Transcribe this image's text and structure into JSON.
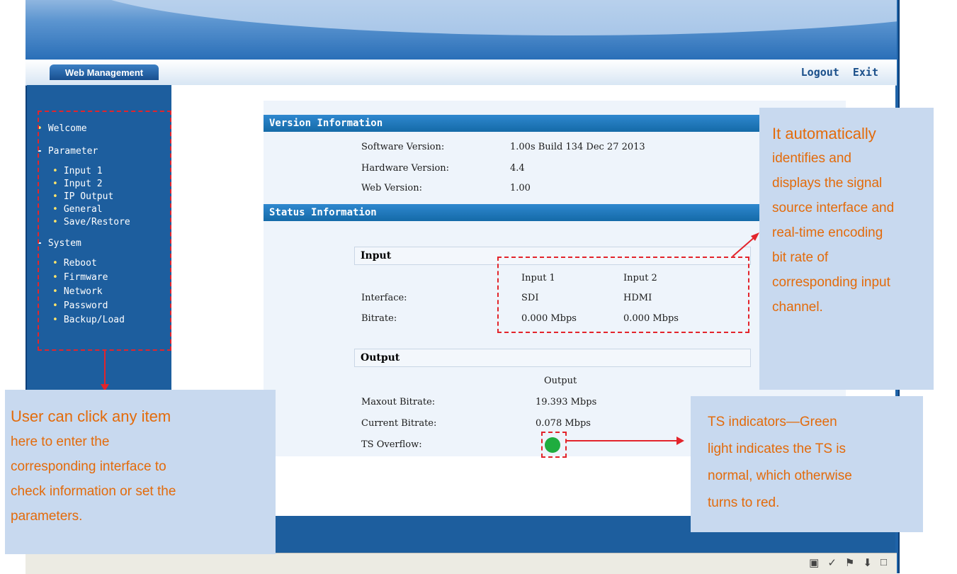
{
  "header": {
    "tab_label": "Web Management",
    "logout_label": "Logout",
    "exit_label": "Exit"
  },
  "sidebar": {
    "items": [
      {
        "label": "Welcome",
        "level": 0,
        "marker": "•"
      },
      {
        "label": "Parameter",
        "level": 0,
        "marker": "-"
      },
      {
        "label": "Input 1",
        "level": 1,
        "marker": "•"
      },
      {
        "label": "Input 2",
        "level": 1,
        "marker": "•"
      },
      {
        "label": "IP Output",
        "level": 1,
        "marker": "•"
      },
      {
        "label": "General",
        "level": 1,
        "marker": "•"
      },
      {
        "label": "Save/Restore",
        "level": 1,
        "marker": "•"
      },
      {
        "label": "System",
        "level": 0,
        "marker": "-"
      },
      {
        "label": "Reboot",
        "level": 1,
        "marker": "•"
      },
      {
        "label": "Firmware",
        "level": 1,
        "marker": "•"
      },
      {
        "label": "Network",
        "level": 1,
        "marker": "•"
      },
      {
        "label": "Password",
        "level": 1,
        "marker": "•"
      },
      {
        "label": "Backup/Load",
        "level": 1,
        "marker": "•"
      }
    ]
  },
  "version": {
    "title": "Version Information",
    "software_label": "Software Version:",
    "software_value": "1.00s Build 134 Dec 27 2013",
    "hardware_label": "Hardware Version:",
    "hardware_value": "4.4",
    "web_label": "Web Version:",
    "web_value": "1.00"
  },
  "status": {
    "title": "Status Information",
    "input": {
      "heading": "Input",
      "col1": "Input 1",
      "col2": "Input 2",
      "interface_label": "Interface:",
      "interface_1": "SDI",
      "interface_2": "HDMI",
      "bitrate_label": "Bitrate:",
      "bitrate_1": "0.000 Mbps",
      "bitrate_2": "0.000 Mbps"
    },
    "output": {
      "heading": "Output",
      "col": "Output",
      "maxout_label": "Maxout Bitrate:",
      "maxout_value": "19.393 Mbps",
      "current_label": "Current Bitrate:",
      "current_value": "0.078 Mbps",
      "overflow_label": "TS Overflow:",
      "overflow_color": "#1fad3f"
    }
  },
  "annotations": {
    "right": {
      "line1": "It automatically",
      "rest": [
        "identifies and",
        "displays the signal",
        "source interface and",
        "real-time encoding",
        "bit rate of",
        "corresponding input",
        "channel."
      ]
    },
    "left": {
      "line1": "User can click any item",
      "rest": [
        "here to enter the",
        "corresponding interface to",
        "check information or set the",
        "parameters."
      ]
    },
    "ts": {
      "lines": [
        "TS indicators—Green",
        "light indicates the TS is",
        "normal, which otherwise",
        "turns to red."
      ]
    }
  },
  "status_bar": {
    "icons": [
      "page-icon",
      "brush-icon",
      "flag-icon",
      "download-icon",
      "window-icon"
    ]
  },
  "colors": {
    "accent": "#1d5e9e",
    "annotation_text": "#e36b0b",
    "annotation_bg": "#c8d9ef",
    "dashed_border": "#e3242b"
  }
}
